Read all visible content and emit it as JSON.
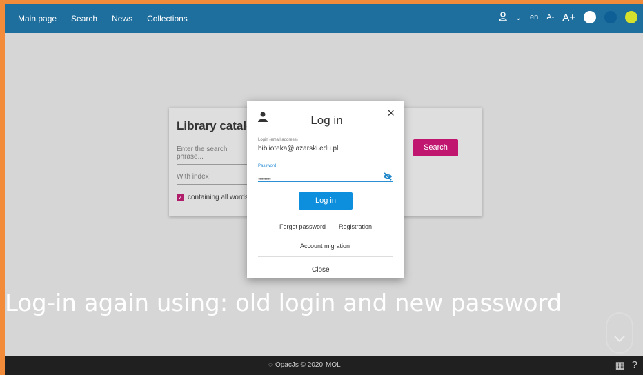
{
  "nav": {
    "items": [
      "Main page",
      "Search",
      "News",
      "Collections"
    ],
    "language": "en",
    "font_small": "A-",
    "font_large": "A+"
  },
  "catalog": {
    "title": "Library catalog",
    "search_placeholder": "Enter the search phrase...",
    "index_placeholder": "With index",
    "checkbox_label": "containing all words",
    "search_button": "Search"
  },
  "modal": {
    "title": "Log in",
    "login_label": "Login (email address)",
    "login_value": "biblioteka@lazarski.edu.pl",
    "password_label": "Password",
    "password_mask": "••••••••••",
    "login_button": "Log in",
    "forgot_password": "Forgot password",
    "registration": "Registration",
    "account_migration": "Account migration",
    "close": "Close"
  },
  "caption": "Log-in again using: old login and new password",
  "footer": {
    "text": "OpacJs © 2020",
    "brand": "MOL"
  },
  "colors": {
    "topbar": "#1e6f9e",
    "accent_button": "#0d8fdd",
    "search_button": "#c01670",
    "orange_border": "#f28c3a"
  }
}
